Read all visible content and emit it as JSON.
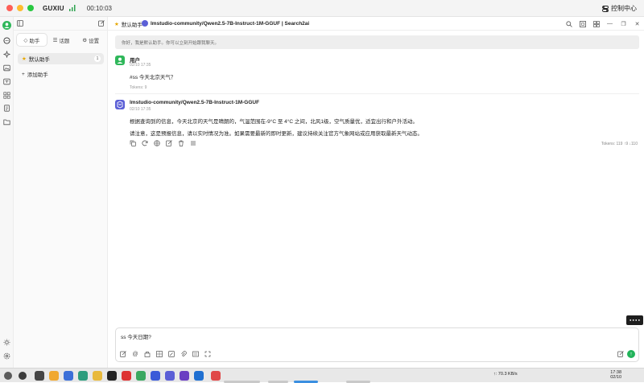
{
  "titlebar": {
    "app_name": "GUXIU",
    "signal_icon": "signal-bars-icon",
    "timer": "00:10:03",
    "control_center_label": "控制中心"
  },
  "rail": {
    "icons": [
      "avatar",
      "chat-icon",
      "sparkle-icon",
      "image-icon",
      "translate-icon",
      "apps-icon",
      "notes-icon",
      "folder-icon",
      "sun-icon",
      "settings-icon"
    ]
  },
  "sidebar": {
    "tabs": [
      {
        "label": "助手",
        "icon": "robot-icon",
        "active": true
      },
      {
        "label": "话题",
        "icon": "list-icon",
        "active": false
      },
      {
        "label": "设置",
        "icon": "gear-icon",
        "active": false
      }
    ],
    "assistant": {
      "label": "默认助手",
      "icon": "star-icon",
      "count": "1"
    },
    "add_assistant": "添加助手"
  },
  "chat_header": {
    "topic": "默认助手",
    "model": "lmstudio-community/Qwen2.5-7B-Instruct-1M-GGUF | Search2ai"
  },
  "greeting": "你好，我是默认助手。你可以立刻开始跟我聊天。",
  "messages": [
    {
      "role": "user",
      "name": "用户",
      "time": "02/10 17:35",
      "lines": [
        "#ss 今天北京天气？"
      ],
      "tokens": "Tokens: 9"
    },
    {
      "role": "assistant",
      "name": "lmstudio-community/Qwen2.5-7B-Instruct-1M-GGUF",
      "time": "02/10 17:35",
      "lines": [
        "根据查询到的信息，今天北京的天气是晴朗的，气温范围在-9°C 至 4°C 之间，北风1级，空气质量优，适宜出行和户外活动。",
        "请注意，这是预报信息，请以实时情况为准。如果需要最新的即时更新，建议持续关注官方气象网站或应用获取最新天气动态。"
      ],
      "tokens": "Tokens: 119 ↑9 ↓110"
    }
  ],
  "message_actions": [
    "copy-icon",
    "refresh-icon",
    "translate-icon",
    "edit-icon",
    "delete-icon",
    "menu-icon"
  ],
  "input": {
    "value": "ss 今天日期?",
    "tools": [
      "clear-icon",
      "mention-icon",
      "web-icon",
      "kb-icon",
      "attach-icon",
      "mcp-icon",
      "expand-icon",
      "fullscreen-icon"
    ]
  },
  "widget": {
    "label": "● ● ● ●"
  },
  "taskbar": {
    "speed": "↑: 70.3 KB/s",
    "time": "17:38",
    "date": "02/10"
  },
  "colors": {
    "accent_green": "#22b35a",
    "user_avatar": "#2fb75a",
    "model_avatar": "#5b5fd6",
    "greeting_bg": "#eeeeee"
  }
}
